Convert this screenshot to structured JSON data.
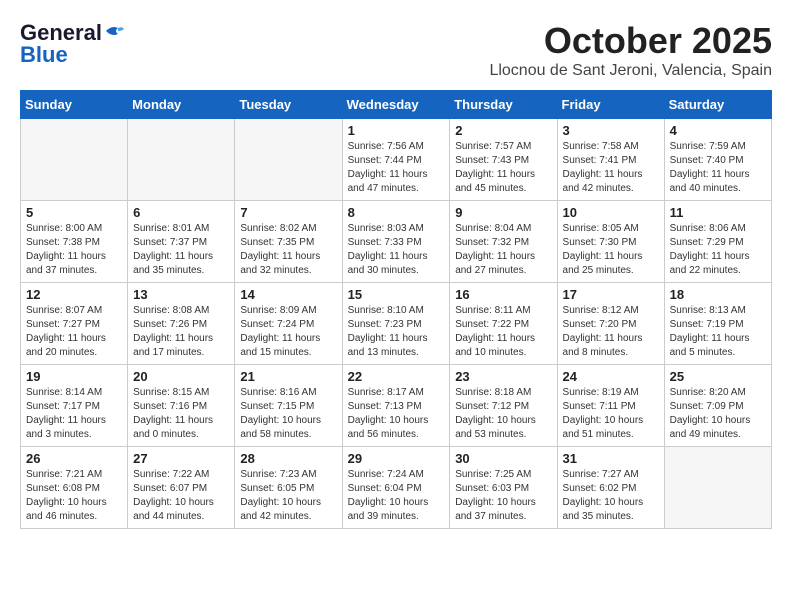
{
  "header": {
    "logo_line1": "General",
    "logo_line2": "Blue",
    "title": "October 2025",
    "subtitle": "Llocnou de Sant Jeroni, Valencia, Spain"
  },
  "weekdays": [
    "Sunday",
    "Monday",
    "Tuesday",
    "Wednesday",
    "Thursday",
    "Friday",
    "Saturday"
  ],
  "weeks": [
    [
      {
        "day": "",
        "info": ""
      },
      {
        "day": "",
        "info": ""
      },
      {
        "day": "",
        "info": ""
      },
      {
        "day": "1",
        "info": "Sunrise: 7:56 AM\nSunset: 7:44 PM\nDaylight: 11 hours\nand 47 minutes."
      },
      {
        "day": "2",
        "info": "Sunrise: 7:57 AM\nSunset: 7:43 PM\nDaylight: 11 hours\nand 45 minutes."
      },
      {
        "day": "3",
        "info": "Sunrise: 7:58 AM\nSunset: 7:41 PM\nDaylight: 11 hours\nand 42 minutes."
      },
      {
        "day": "4",
        "info": "Sunrise: 7:59 AM\nSunset: 7:40 PM\nDaylight: 11 hours\nand 40 minutes."
      }
    ],
    [
      {
        "day": "5",
        "info": "Sunrise: 8:00 AM\nSunset: 7:38 PM\nDaylight: 11 hours\nand 37 minutes."
      },
      {
        "day": "6",
        "info": "Sunrise: 8:01 AM\nSunset: 7:37 PM\nDaylight: 11 hours\nand 35 minutes."
      },
      {
        "day": "7",
        "info": "Sunrise: 8:02 AM\nSunset: 7:35 PM\nDaylight: 11 hours\nand 32 minutes."
      },
      {
        "day": "8",
        "info": "Sunrise: 8:03 AM\nSunset: 7:33 PM\nDaylight: 11 hours\nand 30 minutes."
      },
      {
        "day": "9",
        "info": "Sunrise: 8:04 AM\nSunset: 7:32 PM\nDaylight: 11 hours\nand 27 minutes."
      },
      {
        "day": "10",
        "info": "Sunrise: 8:05 AM\nSunset: 7:30 PM\nDaylight: 11 hours\nand 25 minutes."
      },
      {
        "day": "11",
        "info": "Sunrise: 8:06 AM\nSunset: 7:29 PM\nDaylight: 11 hours\nand 22 minutes."
      }
    ],
    [
      {
        "day": "12",
        "info": "Sunrise: 8:07 AM\nSunset: 7:27 PM\nDaylight: 11 hours\nand 20 minutes."
      },
      {
        "day": "13",
        "info": "Sunrise: 8:08 AM\nSunset: 7:26 PM\nDaylight: 11 hours\nand 17 minutes."
      },
      {
        "day": "14",
        "info": "Sunrise: 8:09 AM\nSunset: 7:24 PM\nDaylight: 11 hours\nand 15 minutes."
      },
      {
        "day": "15",
        "info": "Sunrise: 8:10 AM\nSunset: 7:23 PM\nDaylight: 11 hours\nand 13 minutes."
      },
      {
        "day": "16",
        "info": "Sunrise: 8:11 AM\nSunset: 7:22 PM\nDaylight: 11 hours\nand 10 minutes."
      },
      {
        "day": "17",
        "info": "Sunrise: 8:12 AM\nSunset: 7:20 PM\nDaylight: 11 hours\nand 8 minutes."
      },
      {
        "day": "18",
        "info": "Sunrise: 8:13 AM\nSunset: 7:19 PM\nDaylight: 11 hours\nand 5 minutes."
      }
    ],
    [
      {
        "day": "19",
        "info": "Sunrise: 8:14 AM\nSunset: 7:17 PM\nDaylight: 11 hours\nand 3 minutes."
      },
      {
        "day": "20",
        "info": "Sunrise: 8:15 AM\nSunset: 7:16 PM\nDaylight: 11 hours\nand 0 minutes."
      },
      {
        "day": "21",
        "info": "Sunrise: 8:16 AM\nSunset: 7:15 PM\nDaylight: 10 hours\nand 58 minutes."
      },
      {
        "day": "22",
        "info": "Sunrise: 8:17 AM\nSunset: 7:13 PM\nDaylight: 10 hours\nand 56 minutes."
      },
      {
        "day": "23",
        "info": "Sunrise: 8:18 AM\nSunset: 7:12 PM\nDaylight: 10 hours\nand 53 minutes."
      },
      {
        "day": "24",
        "info": "Sunrise: 8:19 AM\nSunset: 7:11 PM\nDaylight: 10 hours\nand 51 minutes."
      },
      {
        "day": "25",
        "info": "Sunrise: 8:20 AM\nSunset: 7:09 PM\nDaylight: 10 hours\nand 49 minutes."
      }
    ],
    [
      {
        "day": "26",
        "info": "Sunrise: 7:21 AM\nSunset: 6:08 PM\nDaylight: 10 hours\nand 46 minutes."
      },
      {
        "day": "27",
        "info": "Sunrise: 7:22 AM\nSunset: 6:07 PM\nDaylight: 10 hours\nand 44 minutes."
      },
      {
        "day": "28",
        "info": "Sunrise: 7:23 AM\nSunset: 6:05 PM\nDaylight: 10 hours\nand 42 minutes."
      },
      {
        "day": "29",
        "info": "Sunrise: 7:24 AM\nSunset: 6:04 PM\nDaylight: 10 hours\nand 39 minutes."
      },
      {
        "day": "30",
        "info": "Sunrise: 7:25 AM\nSunset: 6:03 PM\nDaylight: 10 hours\nand 37 minutes."
      },
      {
        "day": "31",
        "info": "Sunrise: 7:27 AM\nSunset: 6:02 PM\nDaylight: 10 hours\nand 35 minutes."
      },
      {
        "day": "",
        "info": ""
      }
    ]
  ]
}
